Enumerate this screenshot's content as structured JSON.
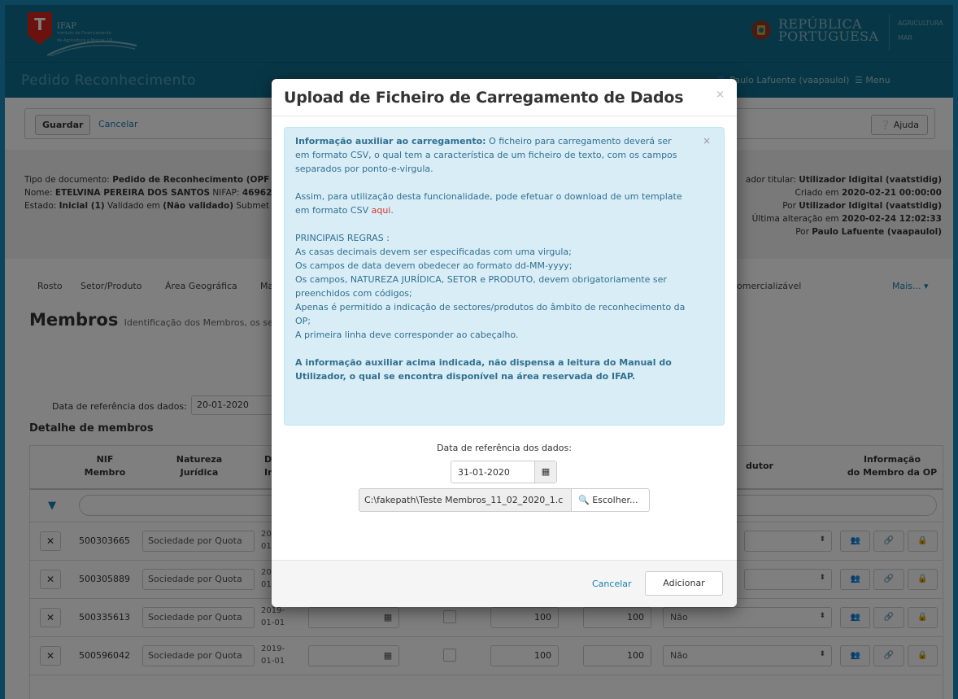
{
  "header": {
    "logo_letter": "T",
    "ifap": "IFAP",
    "ifap_sub1": "Instituto de Financiamento",
    "ifap_sub2": "da Agricultura e Pescas, I.P.",
    "republica_line1": "REPÚBLICA",
    "republica_line2": "PORTUGUESA",
    "right_line1": "AGRICULTURA",
    "right_line2": "MAR",
    "page_title": "Pedido Reconhecimento",
    "user": "Paulo Lafuente (vaapaulol)",
    "menu": "Menu"
  },
  "toolbar": {
    "guardar": "Guardar",
    "cancelar": "Cancelar",
    "ajuda": "Ajuda"
  },
  "docinfo": {
    "tipo_label": "Tipo de documento: ",
    "tipo_value": "Pedido de Reconhecimento (OPF",
    "nome_label": "Nome: ",
    "nome_value": "ETELVINA PEREIRA DOS SANTOS",
    "nifap_label": " NIFAP: ",
    "nifap_value": "46962",
    "estado_label": "Estado: ",
    "estado_value": "Inicial (1)",
    "validado_label": " Validado em ",
    "validado_value": "(Não validado)",
    "submet": " Submet",
    "titular_label": "ador titular: ",
    "titular_value": "Utilizador Idigital (vaatstidig)",
    "criado_label": "Criado em ",
    "criado_value": "2020-02-21 00:00:00",
    "por1_label": "Por ",
    "por1_value": "Utilizador Idigital (vaatstidig)",
    "ultima_label": "Última alteração em ",
    "ultima_value": "2020-02-24 12:02:33",
    "por2_label": "Por ",
    "por2_value": "Paulo Lafuente (vaapaulol)"
  },
  "tabs": [
    "Rosto",
    "Setor/Produto",
    "Área Geográfica",
    "Ma",
    "omercializável",
    "Mais... ▾"
  ],
  "membros": {
    "title": "Membros",
    "subtitle": "Identificação dos Membros, os seus",
    "dataref_label": "Data de referência dos dados:",
    "dataref_value": "20-01-2020",
    "detalhe": "Detalhe de membros"
  },
  "table": {
    "headers": {
      "nif": "NIF\nMembro",
      "natureza": "Natureza\nJurídica",
      "da": "Da\nIn",
      "produtor": "dutor",
      "informacao": "Informação\ndo Membro da OP"
    },
    "rows": [
      {
        "nif": "500303665",
        "natureza": "Sociedade por Quota",
        "date1": "20",
        "date2": "01",
        "val1": "",
        "val2": "",
        "prod": ""
      },
      {
        "nif": "500305889",
        "natureza": "Sociedade por Quota",
        "date1": "20",
        "date2": "01",
        "val1": "",
        "val2": "",
        "prod": ""
      },
      {
        "nif": "500335613",
        "natureza": "Sociedade por Quota",
        "date1": "2019-",
        "date2": "01-01",
        "val1": "100",
        "val2": "100",
        "prod": "Não"
      },
      {
        "nif": "500596042",
        "natureza": "Sociedade por Quota",
        "date1": "2019-",
        "date2": "01-01",
        "val1": "100",
        "val2": "100",
        "prod": "Não"
      }
    ]
  },
  "modal": {
    "title": "Upload de Ficheiro de Carregamento de Dados",
    "close": "×",
    "alert": {
      "lead_bold": "Informação auxiliar ao carregamento:",
      "lead_text": " O ficheiro para carregamento deverá ser em formato CSV, o qual tem a característica de um ficheiro de texto, com os campos separados por ponto-e-virgula.",
      "template_text": "Assim, para utilização desta funcionalidade, pode efetuar o download de um template em formato CSV ",
      "template_link": "aqui",
      "template_end": ".",
      "rules_title": "PRINCIPAIS REGRAS :",
      "rules": [
        "As casas decimais devem ser especificadas com uma virgula;",
        "Os campos de data devem obedecer ao formato dd-MM-yyyy;",
        "Os campos, NATUREZA JURÍDICA, SETOR e PRODUTO, devem obrigatoriamente ser preenchidos com códigos;",
        "Apenas é permitido a indicação de sectores/produtos do âmbito de reconhecimento da OP;",
        "A primeira linha deve corresponder ao cabeçalho."
      ],
      "footer_bold": "A informação auxiliar acima indicada, não dispensa a leitura do Manual do Utilizador, o qual se encontra disponível na área reservada do IFAP."
    },
    "dataref_label": "Data de referência dos dados:",
    "dataref_value": "31-01-2020",
    "file_value": "C:\\fakepath\\Teste Membros_11_02_2020_1.c",
    "file_button": "Escolher...",
    "cancel": "Cancelar",
    "add": "Adicionar"
  },
  "colors": {
    "header_bg": "#0f6f8c",
    "frame": "#1a8bbf",
    "alert_bg": "#d9edf7",
    "alert_text": "#31708f",
    "link": "#1a7fb3"
  }
}
